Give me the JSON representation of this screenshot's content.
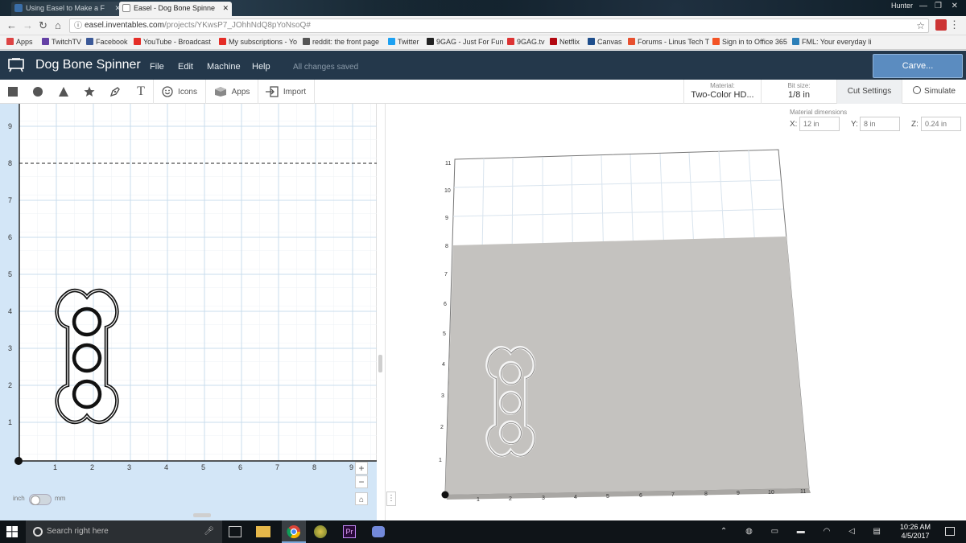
{
  "browser": {
    "tabs": [
      {
        "title": "Using Easel to Make a F"
      },
      {
        "title": "Easel - Dog Bone Spinne"
      }
    ],
    "user": "Hunter",
    "url": {
      "host": "easel.inventables.com",
      "path": "/projects/YKwsP7_JOhhNdQ8pYoNsoQ#"
    },
    "bookmarks": [
      {
        "label": "Apps",
        "color": "#d44"
      },
      {
        "label": "TwitchTV",
        "color": "#6441a5"
      },
      {
        "label": "Facebook",
        "color": "#3b5998"
      },
      {
        "label": "YouTube - Broadcast",
        "color": "#e52d27"
      },
      {
        "label": "My subscriptions - Yo",
        "color": "#e52d27"
      },
      {
        "label": "reddit: the front page",
        "color": "#555"
      },
      {
        "label": "Twitter",
        "color": "#1da1f2"
      },
      {
        "label": "9GAG - Just For Fun",
        "color": "#222"
      },
      {
        "label": "9GAG.tv",
        "color": "#d33"
      },
      {
        "label": "Netflix",
        "color": "#b20710"
      },
      {
        "label": "Canvas",
        "color": "#1e4e8c"
      },
      {
        "label": "Forums - Linus Tech T",
        "color": "#e8502f"
      },
      {
        "label": "Sign in to Office 365",
        "color": "#f35325"
      },
      {
        "label": "FML: Your everyday li",
        "color": "#2c7fb8"
      }
    ]
  },
  "app": {
    "project_title": "Dog Bone Spinner",
    "menu": [
      "File",
      "Edit",
      "Machine",
      "Help"
    ],
    "save_status": "All changes saved",
    "carve_label": "Carve..."
  },
  "toolbar": {
    "icons_label": "Icons",
    "apps_label": "Apps",
    "import_label": "Import",
    "material_caption": "Material:",
    "material_value": "Two-Color HD...",
    "bit_caption": "Bit size:",
    "bit_value": "1/8 in",
    "cut_settings": "Cut Settings",
    "simulate": "Simulate"
  },
  "workspace": {
    "y_ticks": [
      "9",
      "8",
      "7",
      "6",
      "5",
      "4",
      "3",
      "2",
      "1"
    ],
    "x_ticks": [
      "1",
      "2",
      "3",
      "4",
      "5",
      "6",
      "7",
      "8",
      "9"
    ],
    "unit_inch": "inch",
    "unit_mm": "mm",
    "zoom_in": "+",
    "zoom_out": "−"
  },
  "preview": {
    "material_dimensions_label": "Material dimensions",
    "x_label": "X:",
    "x_value": "12 in",
    "y_label": "Y:",
    "y_value": "8 in",
    "z_label": "Z:",
    "z_value": "0.24 in",
    "y_ticks": [
      "11",
      "10",
      "9",
      "8",
      "7",
      "6",
      "5",
      "4",
      "3",
      "2",
      "1"
    ],
    "x_ticks": [
      "1",
      "2",
      "3",
      "4",
      "5",
      "6",
      "7",
      "8",
      "9",
      "10",
      "11"
    ]
  },
  "taskbar": {
    "search_placeholder": "Search right here",
    "time": "10:26 AM",
    "date": "4/5/2017"
  }
}
